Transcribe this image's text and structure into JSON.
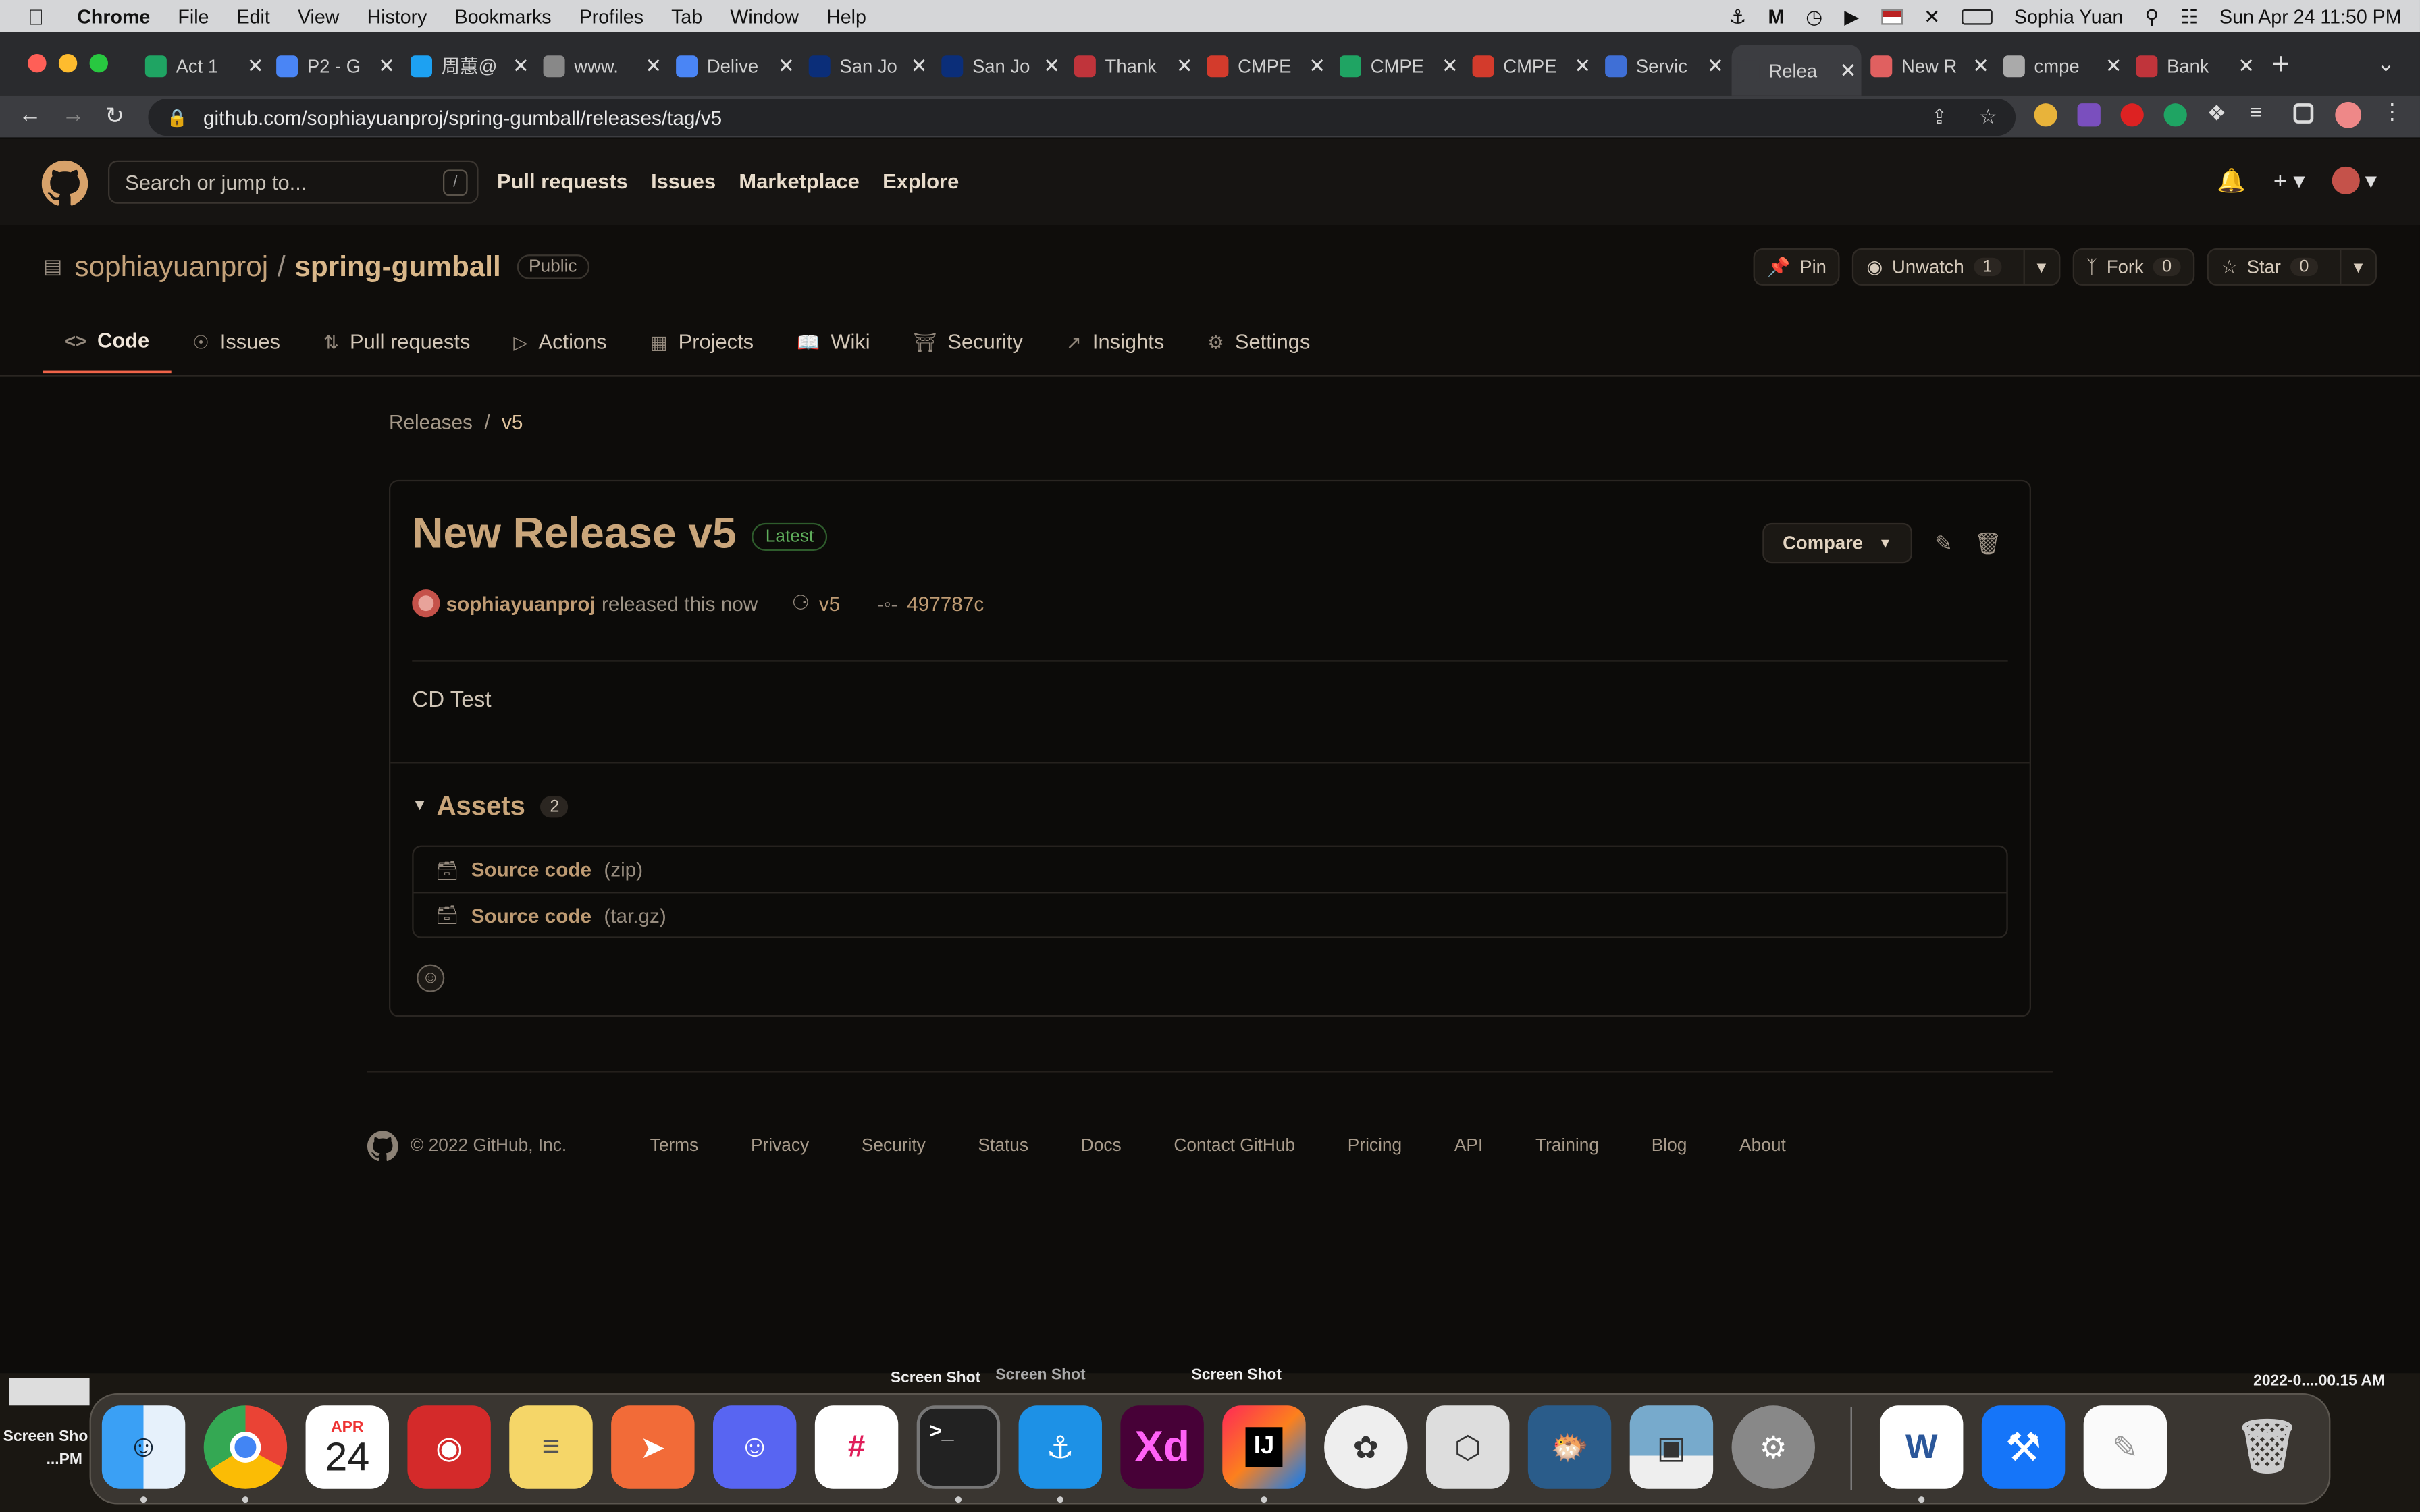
{
  "menubar": {
    "app": "Chrome",
    "items": [
      "File",
      "Edit",
      "View",
      "History",
      "Bookmarks",
      "Profiles",
      "Tab",
      "Window",
      "Help"
    ],
    "user": "Sophia Yuan",
    "datetime": "Sun Apr 24  11:50 PM"
  },
  "tabs": [
    {
      "title": "Act 1",
      "color": "#1fa463"
    },
    {
      "title": "P2 - G",
      "color": "#4a85f5"
    },
    {
      "title": "周蕙@",
      "color": "#1da1f2"
    },
    {
      "title": "www.",
      "color": "#888888"
    },
    {
      "title": "Delive",
      "color": "#4a85f5"
    },
    {
      "title": "San Jo",
      "color": "#0b2e79"
    },
    {
      "title": "San Jo",
      "color": "#0b2e79"
    },
    {
      "title": "Thank",
      "color": "#c0343b"
    },
    {
      "title": "CMPE",
      "color": "#d33b2c"
    },
    {
      "title": "CMPE",
      "color": "#1fa463"
    },
    {
      "title": "CMPE",
      "color": "#d33b2c"
    },
    {
      "title": "Servic",
      "color": "#3f6fd6"
    },
    {
      "title": "Relea",
      "color": "#3c3d41"
    },
    {
      "title": "New R",
      "color": "#e06060"
    },
    {
      "title": "cmpe",
      "color": "#aaaaaa"
    },
    {
      "title": "Bank",
      "color": "#c0343b"
    }
  ],
  "address": {
    "url": "github.com/sophiayuanproj/spring-gumball/releases/tag/v5"
  },
  "github": {
    "search_placeholder": "Search or jump to...",
    "slash": "/",
    "nav": [
      "Pull requests",
      "Issues",
      "Marketplace",
      "Explore"
    ]
  },
  "repo": {
    "owner": "sophiayuanproj",
    "sep": "/",
    "name": "spring-gumball",
    "visibility": "Public",
    "pin": "Pin",
    "unwatch": "Unwatch",
    "unwatch_count": "1",
    "fork": "Fork",
    "fork_count": "0",
    "star": "Star",
    "star_count": "0",
    "tabs": [
      "Code",
      "Issues",
      "Pull requests",
      "Actions",
      "Projects",
      "Wiki",
      "Security",
      "Insights",
      "Settings"
    ]
  },
  "breadcrumb": {
    "root": "Releases",
    "sep": "/",
    "current": "v5"
  },
  "release": {
    "title": "New Release v5",
    "badge": "Latest",
    "compare": "Compare",
    "author": "sophiayuanproj",
    "action": "released this now",
    "tag": "v5",
    "commit": "497787c",
    "body": "CD Test",
    "assets_label": "Assets",
    "assets_count": "2",
    "assets": [
      {
        "name": "Source code",
        "ext": "(zip)"
      },
      {
        "name": "Source code",
        "ext": "(tar.gz)"
      }
    ]
  },
  "footer": {
    "copyright": "© 2022 GitHub, Inc.",
    "links": [
      "Terms",
      "Privacy",
      "Security",
      "Status",
      "Docs",
      "Contact GitHub",
      "Pricing",
      "API",
      "Training",
      "Blog",
      "About"
    ]
  },
  "desktop": {
    "files": [
      "Screen Shot",
      "Screen Shot",
      "Screen Shot",
      "2022-0....00.15 AM",
      "Screen Sho",
      "...PM"
    ],
    "calendar_month": "APR",
    "calendar_day": "24"
  }
}
